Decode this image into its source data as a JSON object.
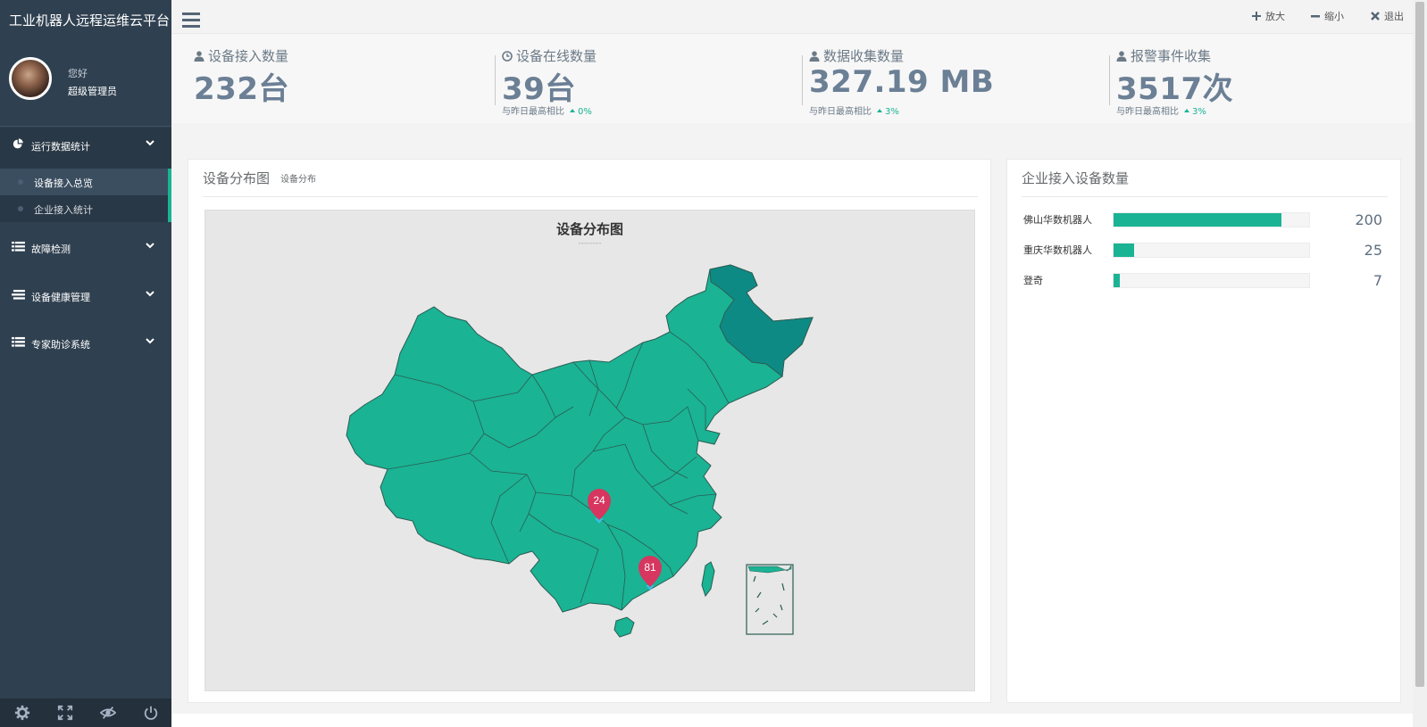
{
  "app": {
    "title": "工业机器人远程运维云平台"
  },
  "profile": {
    "greeting": "您好",
    "role": "超级管理员"
  },
  "sidebar": {
    "items": [
      {
        "label": "运行数据统计",
        "icon": "pie-chart-icon",
        "expanded": true,
        "children": [
          {
            "label": "设备接入总览",
            "active": true
          },
          {
            "label": "企业接入统计",
            "active": false
          }
        ]
      },
      {
        "label": "故障检测",
        "icon": "list-icon"
      },
      {
        "label": "设备健康管理",
        "icon": "list-icon"
      },
      {
        "label": "专家助诊系统",
        "icon": "list-icon"
      }
    ],
    "footer_icons": [
      "gear-icon",
      "expand-icon",
      "eye-slash-icon",
      "power-icon"
    ]
  },
  "topbar": {
    "zoom_in": "放大",
    "zoom_out": "缩小",
    "exit": "退出"
  },
  "stats": [
    {
      "title": "设备接入数量",
      "value": "232台",
      "icon": "user-icon"
    },
    {
      "title": "设备在线数量",
      "value": "39台",
      "compare": "与昨日最高相比",
      "percent": "0%",
      "icon": "clock-icon"
    },
    {
      "title": "数据收集数量",
      "value": "327.19 MB",
      "compare": "与昨日最高相比",
      "percent": "3%",
      "icon": "user-icon"
    },
    {
      "title": "报警事件收集",
      "value": "3517次",
      "compare": "与昨日最高相比",
      "percent": "3%",
      "icon": "user-icon"
    }
  ],
  "map_panel": {
    "title": "设备分布图",
    "subtitle": "设备分布",
    "map_title": "设备分布图",
    "map_subtitle": "--------",
    "markers": [
      {
        "value": "24"
      },
      {
        "value": "81"
      }
    ],
    "colors": {
      "region": "#1ab394",
      "highlight": "#0e8a85",
      "marker": "#d6365f",
      "background": "#e7e7e7"
    }
  },
  "bars_panel": {
    "title": "企业接入设备数量",
    "max": 233,
    "rows": [
      {
        "label": "佛山华数机器人",
        "value": 200
      },
      {
        "label": "重庆华数机器人",
        "value": 25
      },
      {
        "label": "登奇",
        "value": 7
      }
    ]
  }
}
